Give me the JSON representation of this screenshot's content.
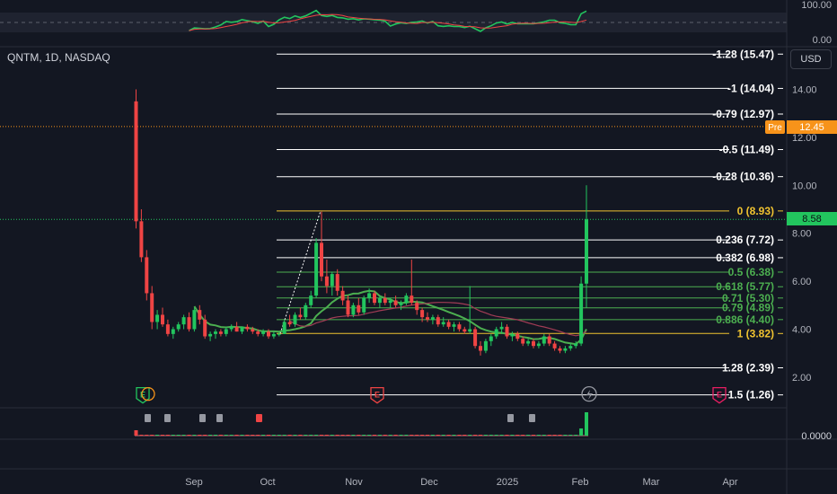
{
  "header": {
    "symbol": "QNTM, 1D, NASDAQ",
    "currency_button": "USD"
  },
  "rsi_axis": [
    "100.00",
    "0.00"
  ],
  "volume_axis": "0.0000",
  "badges": {
    "pre_label": "Pre",
    "pre_value": "12.45",
    "last_value": "8.58",
    "pre_color": "#f7931a",
    "last_color": "#22c55e"
  },
  "chart_data": {
    "type": "candlestick",
    "price_axis": {
      "ticks": [
        2.0,
        4.0,
        6.0,
        8.0,
        10.0,
        12.0,
        14.0
      ],
      "range": [
        1.0,
        16.0
      ]
    },
    "x_labels": [
      "Sep",
      "Oct",
      "Nov",
      "Dec",
      "2025",
      "Feb",
      "Mar",
      "Apr"
    ],
    "fib_levels": [
      {
        "label": "-1.28 (15.47)",
        "price": 15.47,
        "color": "#ffffff"
      },
      {
        "label": "-1 (14.04)",
        "price": 14.04,
        "color": "#ffffff"
      },
      {
        "label": "-0.79 (12.97)",
        "price": 12.97,
        "color": "#ffffff"
      },
      {
        "label": "-0.5 (11.49)",
        "price": 11.49,
        "color": "#ffffff"
      },
      {
        "label": "-0.28 (10.36)",
        "price": 10.36,
        "color": "#ffffff"
      },
      {
        "label": "0 (8.93)",
        "price": 8.93,
        "color": "#f0c330"
      },
      {
        "label": "0.236 (7.72)",
        "price": 7.72,
        "color": "#ffffff"
      },
      {
        "label": "0.382 (6.98)",
        "price": 6.98,
        "color": "#ffffff"
      },
      {
        "label": "0.5 (6.38)",
        "price": 6.38,
        "color": "#4caf50"
      },
      {
        "label": "0.618 (5.77)",
        "price": 5.77,
        "color": "#4caf50"
      },
      {
        "label": "0.71 (5.30)",
        "price": 5.3,
        "color": "#4caf50"
      },
      {
        "label": "0.79 (4.89)",
        "price": 4.89,
        "color": "#4caf50"
      },
      {
        "label": "0.886 (4.40)",
        "price": 4.4,
        "color": "#4caf50"
      },
      {
        "label": "1 (3.82)",
        "price": 3.82,
        "color": "#f0c330"
      },
      {
        "label": "1.28 (2.39)",
        "price": 2.39,
        "color": "#ffffff"
      },
      {
        "label": "1.5 (1.26)",
        "price": 1.26,
        "color": "#ffffff"
      }
    ],
    "pre_market_price": 12.45,
    "last_price": 8.58,
    "candles": [
      [
        13.5,
        14.0,
        8.2,
        8.5
      ],
      [
        8.5,
        9.0,
        6.8,
        7.0
      ],
      [
        7.0,
        7.3,
        5.2,
        5.5
      ],
      [
        5.5,
        5.8,
        4.0,
        4.3
      ],
      [
        4.3,
        4.8,
        4.0,
        4.6
      ],
      [
        4.6,
        4.9,
        4.1,
        4.2
      ],
      [
        4.2,
        4.4,
        3.7,
        3.8
      ],
      [
        3.8,
        4.1,
        3.6,
        4.0
      ],
      [
        4.0,
        4.3,
        3.9,
        4.2
      ],
      [
        4.2,
        4.6,
        4.0,
        4.5
      ],
      [
        4.5,
        4.7,
        3.9,
        4.0
      ],
      [
        4.0,
        4.9,
        3.9,
        4.8
      ],
      [
        4.8,
        5.0,
        4.2,
        4.4
      ],
      [
        4.4,
        4.6,
        3.6,
        3.7
      ],
      [
        3.7,
        3.9,
        3.5,
        3.8
      ],
      [
        3.8,
        4.0,
        3.6,
        3.9
      ],
      [
        3.9,
        4.0,
        3.7,
        3.8
      ],
      [
        3.8,
        4.1,
        3.7,
        4.0
      ],
      [
        4.0,
        4.2,
        3.9,
        4.1
      ],
      [
        4.1,
        4.3,
        3.9,
        3.9
      ],
      [
        3.9,
        4.1,
        3.8,
        4.1
      ],
      [
        4.1,
        4.2,
        3.9,
        4.0
      ],
      [
        4.0,
        4.1,
        3.8,
        3.9
      ],
      [
        3.9,
        4.0,
        3.7,
        3.8
      ],
      [
        3.8,
        4.0,
        3.7,
        3.9
      ],
      [
        3.9,
        4.0,
        3.6,
        3.7
      ],
      [
        3.7,
        3.9,
        3.6,
        3.8
      ],
      [
        3.8,
        3.9,
        3.7,
        3.8
      ],
      [
        3.8,
        4.4,
        3.8,
        4.3
      ],
      [
        4.3,
        4.6,
        4.1,
        4.2
      ],
      [
        4.2,
        4.7,
        4.1,
        4.6
      ],
      [
        4.6,
        4.9,
        4.4,
        4.5
      ],
      [
        4.5,
        5.1,
        4.4,
        5.0
      ],
      [
        5.0,
        5.6,
        4.9,
        5.4
      ],
      [
        5.4,
        7.8,
        5.3,
        7.6
      ],
      [
        7.6,
        8.9,
        6.0,
        6.2
      ],
      [
        6.2,
        6.9,
        5.5,
        5.8
      ],
      [
        5.8,
        6.4,
        5.4,
        6.3
      ],
      [
        6.3,
        6.5,
        5.4,
        5.6
      ],
      [
        5.6,
        5.8,
        5.0,
        5.2
      ],
      [
        5.2,
        5.4,
        4.5,
        4.6
      ],
      [
        4.6,
        5.1,
        4.5,
        5.0
      ],
      [
        5.0,
        5.3,
        4.6,
        4.7
      ],
      [
        4.7,
        5.4,
        4.6,
        5.3
      ],
      [
        5.3,
        5.7,
        5.1,
        5.5
      ],
      [
        5.5,
        5.6,
        5.0,
        5.1
      ],
      [
        5.1,
        5.4,
        4.9,
        5.3
      ],
      [
        5.3,
        5.5,
        5.0,
        5.1
      ],
      [
        5.1,
        5.3,
        4.9,
        5.2
      ],
      [
        5.2,
        5.4,
        4.9,
        5.0
      ],
      [
        5.0,
        5.2,
        4.8,
        5.1
      ],
      [
        5.1,
        5.5,
        5.0,
        5.4
      ],
      [
        5.4,
        6.9,
        5.0,
        5.1
      ],
      [
        5.1,
        5.2,
        4.6,
        4.8
      ],
      [
        4.8,
        4.9,
        4.3,
        4.5
      ],
      [
        4.5,
        4.7,
        4.3,
        4.4
      ],
      [
        4.4,
        4.6,
        4.2,
        4.5
      ],
      [
        4.5,
        4.6,
        4.1,
        4.2
      ],
      [
        4.2,
        4.5,
        4.1,
        4.3
      ],
      [
        4.3,
        4.4,
        4.0,
        4.1
      ],
      [
        4.1,
        4.3,
        3.9,
        4.2
      ],
      [
        4.2,
        4.3,
        3.9,
        4.0
      ],
      [
        4.0,
        4.1,
        3.8,
        3.9
      ],
      [
        3.9,
        5.8,
        3.8,
        4.0
      ],
      [
        4.0,
        4.1,
        3.2,
        3.3
      ],
      [
        3.3,
        3.5,
        2.9,
        3.1
      ],
      [
        3.1,
        3.6,
        3.0,
        3.5
      ],
      [
        3.5,
        3.8,
        3.3,
        3.7
      ],
      [
        3.7,
        4.1,
        3.6,
        4.0
      ],
      [
        4.0,
        4.3,
        3.8,
        4.1
      ],
      [
        4.1,
        4.2,
        3.6,
        3.7
      ],
      [
        3.7,
        3.9,
        3.5,
        3.8
      ],
      [
        3.8,
        3.9,
        3.5,
        3.6
      ],
      [
        3.6,
        3.7,
        3.3,
        3.4
      ],
      [
        3.4,
        3.6,
        3.3,
        3.5
      ],
      [
        3.5,
        3.6,
        3.2,
        3.3
      ],
      [
        3.3,
        3.5,
        3.2,
        3.4
      ],
      [
        3.4,
        3.8,
        3.3,
        3.7
      ],
      [
        3.7,
        3.8,
        3.3,
        3.4
      ],
      [
        3.4,
        3.5,
        3.1,
        3.2
      ],
      [
        3.2,
        3.3,
        3.0,
        3.1
      ],
      [
        3.1,
        3.3,
        3.0,
        3.2
      ],
      [
        3.2,
        3.4,
        3.1,
        3.3
      ],
      [
        3.3,
        3.5,
        3.2,
        3.4
      ],
      [
        3.4,
        6.2,
        3.3,
        5.9
      ],
      [
        5.9,
        10.0,
        4.9,
        8.58
      ]
    ]
  }
}
